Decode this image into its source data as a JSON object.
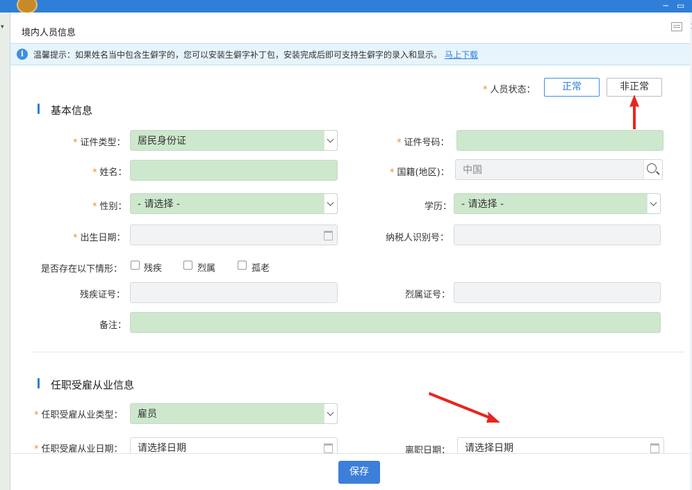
{
  "window": {
    "minimize": "−",
    "maximize": "▭"
  },
  "dialog": {
    "title": "境内人员信息",
    "close_glyph": "×",
    "notice": {
      "text": "温馨提示：如果姓名当中包含生僻字的，您可以安装生僻字补丁包，安装完成后即可支持生僻字的录入和显示。",
      "link": "马上下载"
    }
  },
  "status": {
    "label": "人员状态：",
    "options": [
      "正常",
      "非正常"
    ]
  },
  "basic": {
    "title": "基本信息",
    "id_type": {
      "label": "证件类型：",
      "value": "居民身份证"
    },
    "id_number": {
      "label": "证件号码：",
      "value": ""
    },
    "name": {
      "label": "姓名：",
      "value": ""
    },
    "nationality": {
      "label": "国籍(地区)：",
      "placeholder": "中国"
    },
    "gender": {
      "label": "性别：",
      "value": "- 请选择 -"
    },
    "education": {
      "label": "学历：",
      "value": "- 请选择 -"
    },
    "birth_date": {
      "label": "出生日期：",
      "value": ""
    },
    "taxpayer_id": {
      "label": "纳税人识别号：",
      "value": ""
    },
    "situations": {
      "label": "是否存在以下情形：",
      "options": [
        "残疾",
        "烈属",
        "孤老"
      ]
    },
    "disability_cert": {
      "label": "残疾证号：",
      "value": ""
    },
    "martyr_cert": {
      "label": "烈属证号：",
      "value": ""
    },
    "remarks": {
      "label": "备注：",
      "value": ""
    }
  },
  "employment": {
    "title": "任职受雇从业信息",
    "type": {
      "label": "任职受雇从业类型：",
      "value": "雇员"
    },
    "start_date": {
      "label": "任职受雇从业日期：",
      "placeholder": "请选择日期"
    },
    "leave_date": {
      "label": "离职日期：",
      "placeholder": "请选择日期"
    }
  },
  "footer": {
    "save_label": "保存"
  },
  "colors": {
    "accent": "#2d7ed8",
    "required_field": "#cde8cd",
    "arrow": "#e8261e"
  }
}
